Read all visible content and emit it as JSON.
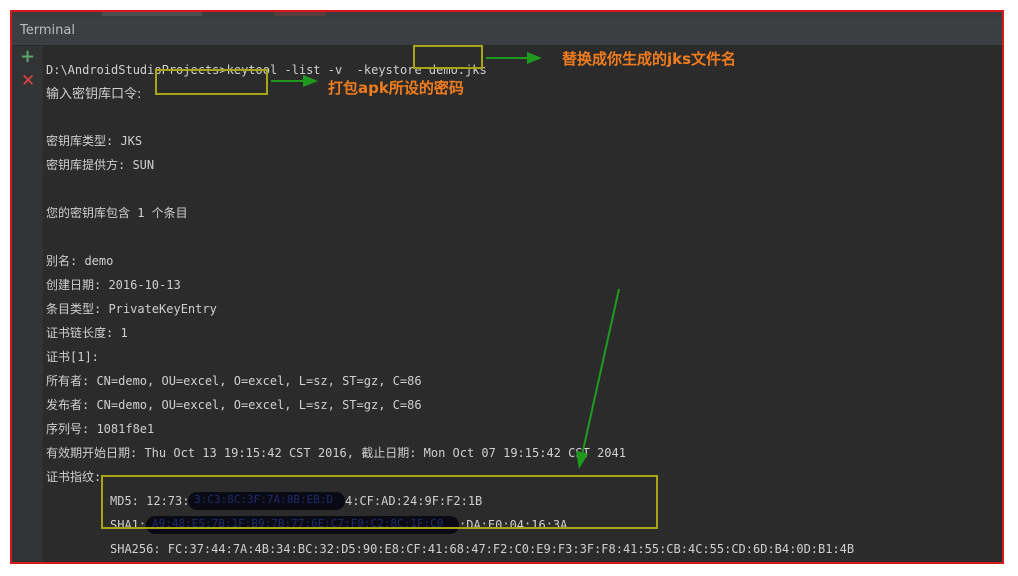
{
  "panel": {
    "title": "Terminal"
  },
  "colors": {
    "accent_annotation": "#f07c1d",
    "highlight_box": "#a8a515",
    "arrow": "#1f9a1f",
    "frame_border": "#d31b1b"
  },
  "terminal": {
    "command": "D:\\AndroidStudioProjects>keytool -list -v  -keystore demo.jks",
    "prompt_label": "输入密钥库口令:",
    "keystore_type": "密钥库类型: JKS",
    "keystore_provider": "密钥库提供方: SUN",
    "contains": "您的密钥库包含 1 个条目",
    "alias": "别名: demo",
    "created": "创建日期: 2016-10-13",
    "entry_type": "条目类型: PrivateKeyEntry",
    "chain_length": "证书链长度: 1",
    "cert": "证书[1]:",
    "owner": "所有者: CN=demo, OU=excel, O=excel, L=sz, ST=gz, C=86",
    "issuer": "发布者: CN=demo, OU=excel, O=excel, L=sz, ST=gz, C=86",
    "serial": "序列号: 1081f8e1",
    "validity": "有效期开始日期: Thu Oct 13 19:15:42 CST 2016, 截止日期: Mon Oct 07 19:15:42 CST 2041",
    "fingerprints_label": "证书指纹:",
    "md5_prefix": "MD5: 12:73:F",
    "md5_redacted": "3:C3:8C:3F:7A:8B:EB:D",
    "md5_suffix": "4:CF:AD:24:9F:F2:1B",
    "sha1_prefix": "SHA1:",
    "sha1_redacted": "A9:48:E5:7B:1F:B9:7B:77:6E:C7:F0:C2:8C:1F:C0",
    "sha1_suffix": ":DA:E0:04:16:3A",
    "sha256": "SHA256: FC:37:44:7A:4B:34:BC:32:D5:90:E8:CF:41:68:47:F2:C0:E9:F3:3F:F8:41:55:CB:4C:55:CD:6D:B4:0D:B1:4B"
  },
  "annotations": {
    "replace_jks": "替换成你生成的jks文件名",
    "apk_password": "打包apk所设的密码"
  }
}
